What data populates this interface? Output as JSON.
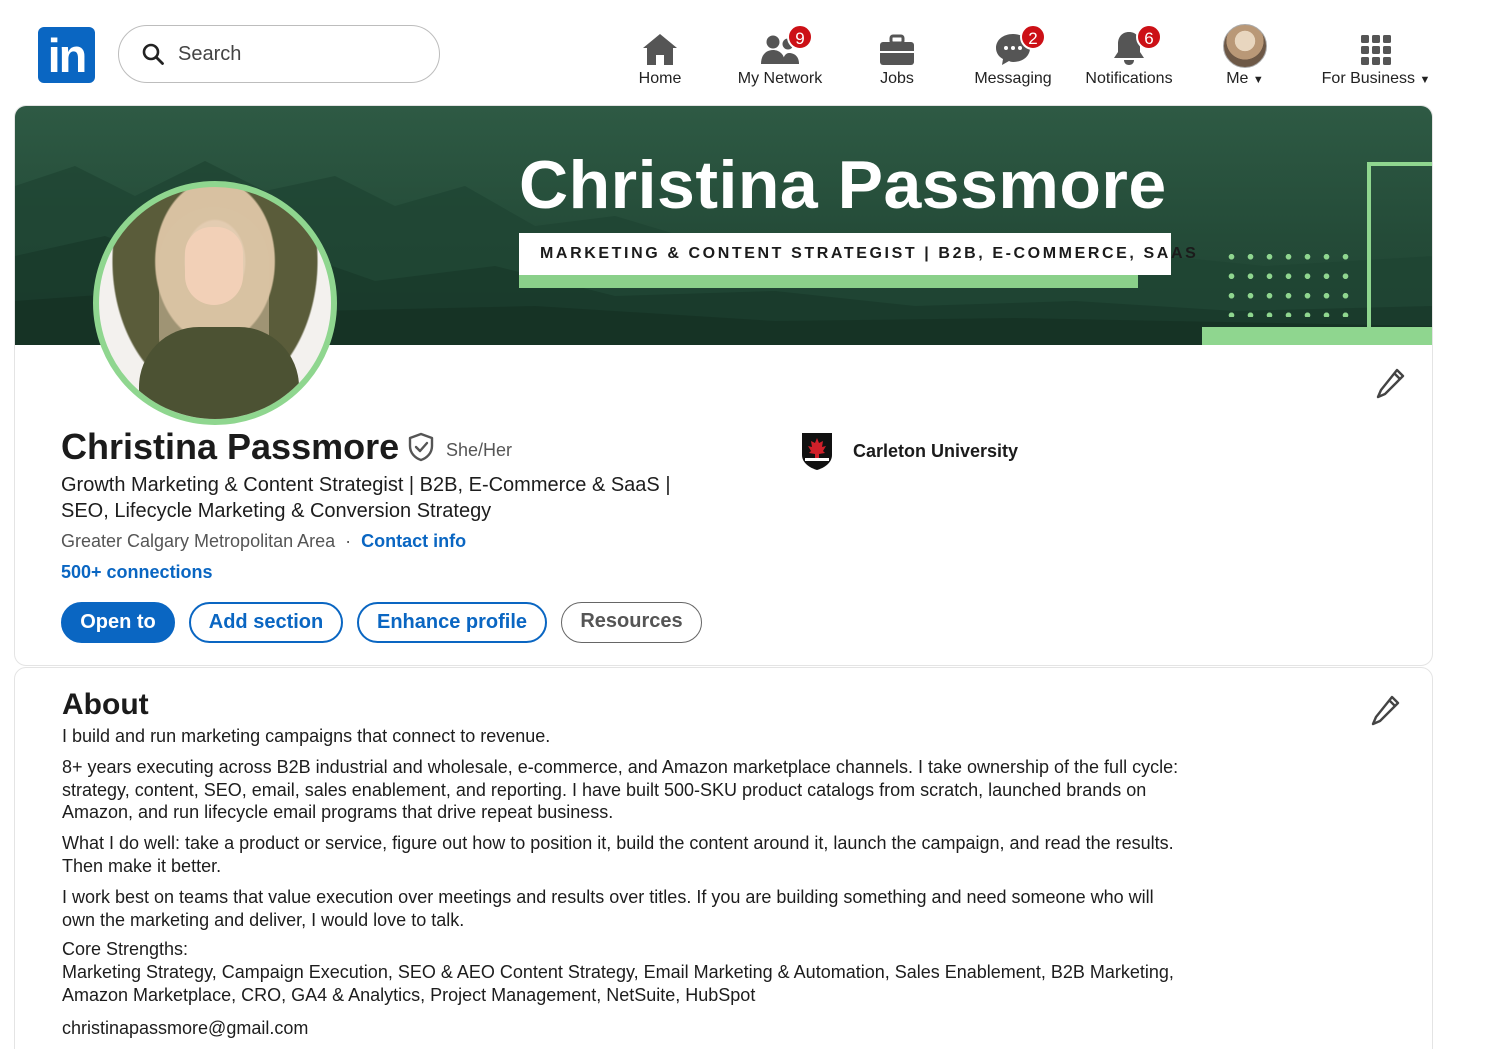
{
  "nav": {
    "logo_text": "in",
    "search_placeholder": "Search",
    "items": [
      {
        "label": "Home",
        "icon": "home-icon"
      },
      {
        "label": "My Network",
        "icon": "people-icon",
        "badge": "9"
      },
      {
        "label": "Jobs",
        "icon": "briefcase-icon"
      },
      {
        "label": "Messaging",
        "icon": "message-icon",
        "badge": "2"
      },
      {
        "label": "Notifications",
        "icon": "bell-icon",
        "badge": "6"
      },
      {
        "label": "Me",
        "icon": "avatar"
      },
      {
        "label": "For Business",
        "icon": "grid-icon"
      }
    ]
  },
  "banner": {
    "title": "Christina Passmore",
    "subtitle": "MARKETING & CONTENT STRATEGIST | B2B, E-COMMERCE, SAAS"
  },
  "profile": {
    "name": "Christina Passmore",
    "pronouns": "She/Her",
    "headline": "Growth Marketing & Content Strategist | B2B, E-Commerce & SaaS | SEO, Lifecycle Marketing & Conversion Strategy",
    "location": "Greater Calgary Metropolitan Area",
    "separator": "·",
    "contact_info": "Contact info",
    "connections": "500+ connections",
    "school": "Carleton University",
    "buttons": {
      "open_to": "Open to",
      "add_section": "Add section",
      "enhance_profile": "Enhance profile",
      "resources": "Resources"
    }
  },
  "about": {
    "heading": "About",
    "p1": "I build and run marketing campaigns that connect to revenue.",
    "p2": "8+ years executing across B2B industrial and wholesale, e-commerce, and Amazon marketplace channels. I take ownership of the full cycle: strategy, content, SEO, email, sales enablement, and reporting. I have built 500-SKU product catalogs from scratch, launched brands on Amazon, and run lifecycle email programs that drive repeat business.",
    "p3": "What I do well: take a product or service, figure out how to position it, build the content around it, launch the campaign, and read the results. Then make it better.",
    "p4": "I work best on teams that value execution over meetings and results over titles. If you are building something and need someone who will own the marketing and deliver, I would love to talk.",
    "core_heading": "Core Strengths:",
    "core_list": "Marketing Strategy, Campaign Execution, SEO & AEO Content Strategy, Email Marketing & Automation, Sales Enablement, B2B Marketing, Amazon Marketplace, CRO, GA4 & Analytics, Project Management, NetSuite, HubSpot",
    "email": "christinapassmore@gmail.com"
  },
  "colors": {
    "linkedin_blue": "#0a66c2",
    "badge_red": "#cc1016",
    "banner_green": "#244b38",
    "accent_green": "#8fd68f"
  }
}
